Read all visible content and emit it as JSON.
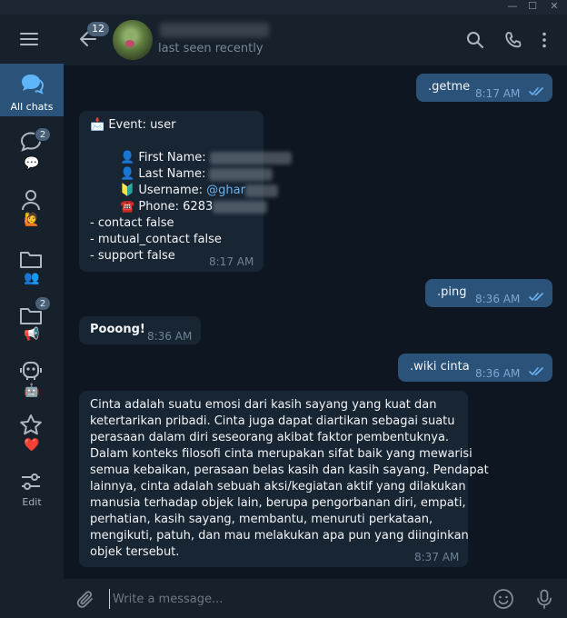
{
  "window": {
    "minimize": "—",
    "maximize": "☐",
    "close": "✕"
  },
  "sidebar": {
    "folders": [
      {
        "label": "All chats",
        "icon": "chats-icon",
        "active": true
      },
      {
        "label": "",
        "icon": "chat-bubble-icon",
        "emoji": "💬",
        "badge": "2"
      },
      {
        "label": "",
        "icon": "user-icon",
        "emoji": "🙋"
      },
      {
        "label": "",
        "icon": "folder-icon",
        "emoji": "👥"
      },
      {
        "label": "",
        "icon": "folder-icon",
        "emoji": "📢",
        "badge": "2"
      },
      {
        "label": "",
        "icon": "bot-icon",
        "emoji": "🤖"
      },
      {
        "label": "",
        "icon": "star-icon",
        "emoji": "❤️"
      },
      {
        "label": "Edit",
        "icon": "sliders-icon"
      }
    ]
  },
  "header": {
    "back_badge": "12",
    "status": "last seen recently"
  },
  "messages": [
    {
      "dir": "out",
      "text": ".getme",
      "time": "8:17 AM"
    },
    {
      "dir": "in",
      "lines": {
        "event": "📩 Event: user",
        "first_name": "👤 First Name: ",
        "last_name": "👤 Last Name: ",
        "username_label": "🔰 Username: ",
        "username_value": "@ghar",
        "phone": "☎️ Phone: 6283",
        "contact": "- contact false",
        "mutual": "- mutual_contact false",
        "support": "- support false"
      },
      "time": "8:17 AM"
    },
    {
      "dir": "out",
      "text": ".ping",
      "time": "8:36 AM"
    },
    {
      "dir": "in",
      "text": "Pooong!",
      "time": "8:36 AM"
    },
    {
      "dir": "out",
      "text": ".wiki cinta",
      "time": "8:36 AM"
    },
    {
      "dir": "in",
      "paragraph": [
        "Cinta adalah suatu emosi dari kasih sayang yang kuat dan",
        "ketertarikan pribadi. Cinta juga dapat diartikan sebagai suatu",
        "perasaan dalam diri seseorang akibat faktor pembentuknya.",
        "Dalam konteks filosofi cinta merupakan sifat baik yang mewarisi",
        "semua kebaikan, perasaan belas kasih dan kasih sayang. Pendapat",
        "lainnya, cinta adalah sebuah aksi/kegiatan aktif yang dilakukan",
        "manusia terhadap objek lain, berupa pengorbanan diri, empati,",
        "perhatian, kasih sayang, membantu, menuruti perkataan,",
        "mengikuti, patuh, dan mau melakukan apa pun yang diinginkan",
        "objek tersebut."
      ],
      "time": "8:37 AM"
    }
  ],
  "composer": {
    "placeholder": "Write a message..."
  },
  "colors": {
    "bg": "#0e1621",
    "panel": "#17212b",
    "incoming": "#182533",
    "outgoing": "#2b5278",
    "accent": "#6ab3f3"
  }
}
